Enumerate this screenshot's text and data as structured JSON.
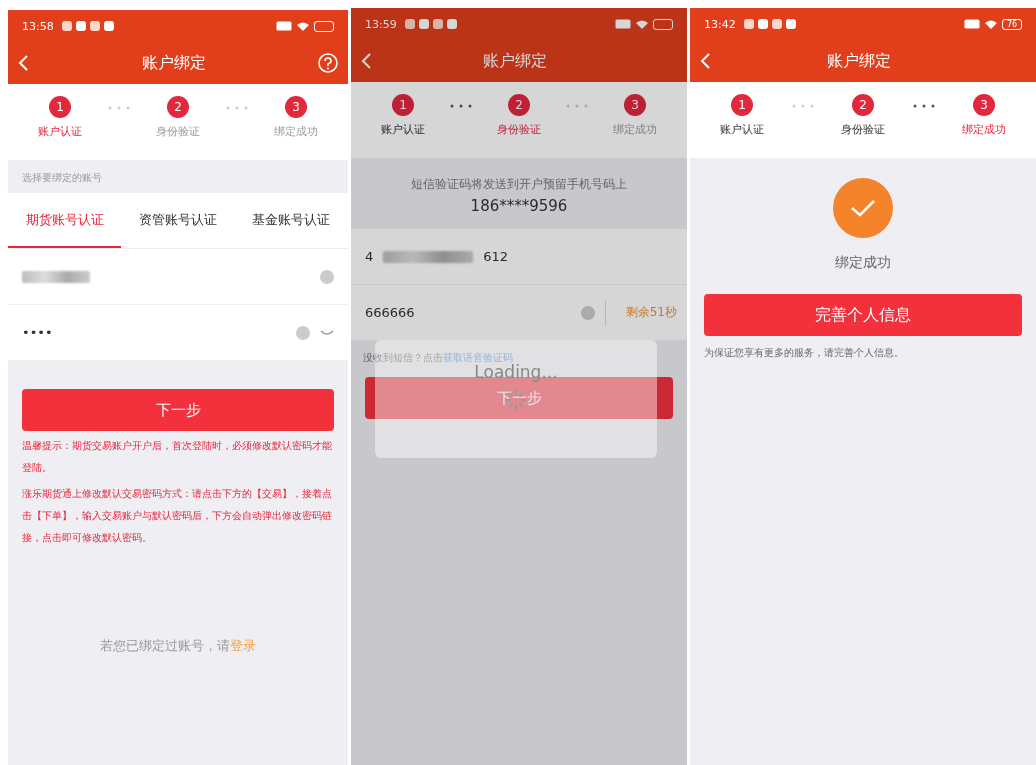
{
  "screens": [
    {
      "kind": "account",
      "status_bar": {
        "time": "13:58"
      },
      "nav": {
        "title": "账户绑定",
        "help": true
      },
      "steps": [
        {
          "number": "1",
          "label": "账户认证",
          "current": true,
          "done": false
        },
        {
          "number": "2",
          "label": "身份验证",
          "current": false,
          "done": false
        },
        {
          "number": "3",
          "label": "绑定成功",
          "current": false,
          "done": false
        }
      ],
      "section_label": "选择要绑定的账号",
      "tabs": [
        {
          "label": "期货账号认证",
          "selected": true
        },
        {
          "label": "资管账号认证",
          "selected": false
        },
        {
          "label": "基金账号认证",
          "selected": false
        }
      ],
      "password_field": {
        "value": "••••"
      },
      "next_button": "下一步",
      "notice": [
        "温馨提示：期货交易账户开户后，首次登陆时，必须修改默认密码才能登陆。",
        "涨乐期货通上修改默认交易密码方式：请点击下方的【交易】，接着点击【下单】，输入交易账户与默认密码后，下方会自动弹出修改密码链接，点击即可修改默认密码。"
      ],
      "footer": {
        "text": "若您已绑定过账号，请",
        "link": "登录"
      }
    },
    {
      "kind": "verify",
      "status_bar": {
        "time": "13:59"
      },
      "nav": {
        "title": "账户绑定",
        "help": false
      },
      "steps": [
        {
          "number": "1",
          "label": "账户认证",
          "current": false,
          "done": true
        },
        {
          "number": "2",
          "label": "身份验证",
          "current": true,
          "done": false
        },
        {
          "number": "3",
          "label": "绑定成功",
          "current": false,
          "done": false
        }
      ],
      "sms_notice": "短信验证码将发送到开户预留手机号码上",
      "phone": "186****9596",
      "account_field": {
        "prefix": "4",
        "suffix": "612"
      },
      "code_field": {
        "value": "666666",
        "countdown": "剩余51秒"
      },
      "voice_hint": {
        "text": "没收到短信？点击",
        "link": "获取语音验证码"
      },
      "next_button": "下一步",
      "loading": {
        "text": "Loading..."
      }
    },
    {
      "kind": "success",
      "status_bar": {
        "time": "13:42",
        "battery": "76"
      },
      "nav": {
        "title": "账户绑定",
        "help": false
      },
      "steps": [
        {
          "number": "1",
          "label": "账户认证",
          "current": false,
          "done": true
        },
        {
          "number": "2",
          "label": "身份验证",
          "current": false,
          "done": true
        },
        {
          "number": "3",
          "label": "绑定成功",
          "current": true,
          "done": false
        }
      ],
      "result": "绑定成功",
      "action_button": "完善个人信息",
      "note": "为保证您享有更多的服务，请完善个人信息。"
    }
  ]
}
